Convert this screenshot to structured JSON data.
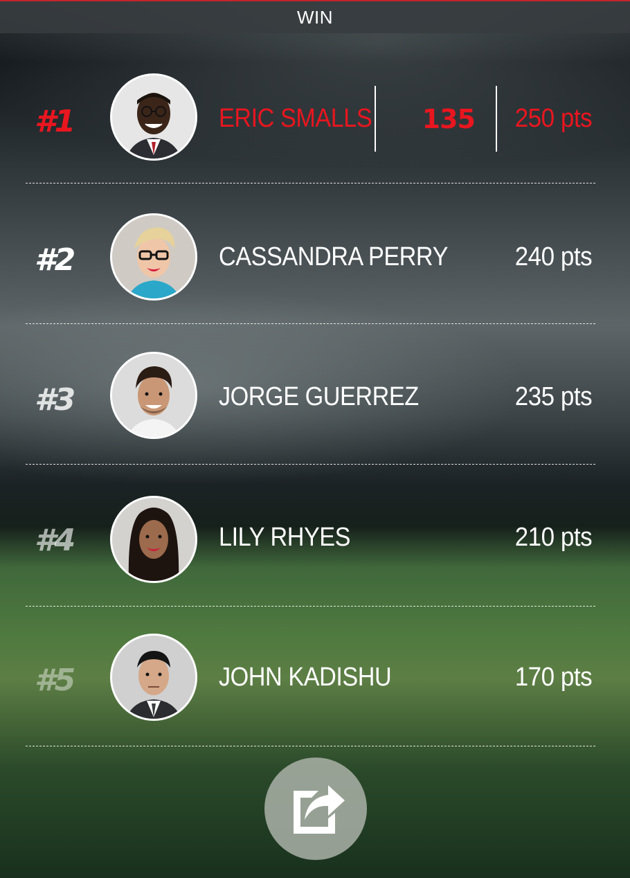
{
  "header": {
    "title": "WIN"
  },
  "accent_color": "#e8161f",
  "leaderboard": [
    {
      "rank": "#1",
      "name": "ERIC SMALLS",
      "score": "135",
      "points": "250 pts",
      "avatar_icon": "avatar-man-glasses-icon"
    },
    {
      "rank": "#2",
      "name": "CASSANDRA PERRY",
      "points": "240 pts",
      "avatar_icon": "avatar-woman-glasses-icon"
    },
    {
      "rank": "#3",
      "name": "JORGE GUERREZ",
      "points": "235 pts",
      "avatar_icon": "avatar-man-curly-hair-icon"
    },
    {
      "rank": "#4",
      "name": "LILY RHYES",
      "points": "210 pts",
      "avatar_icon": "avatar-woman-long-hair-icon"
    },
    {
      "rank": "#5",
      "name": "JOHN KADISHU",
      "points": "170 pts",
      "avatar_icon": "avatar-man-suit-icon"
    }
  ],
  "share_button": {
    "icon": "share-icon"
  }
}
